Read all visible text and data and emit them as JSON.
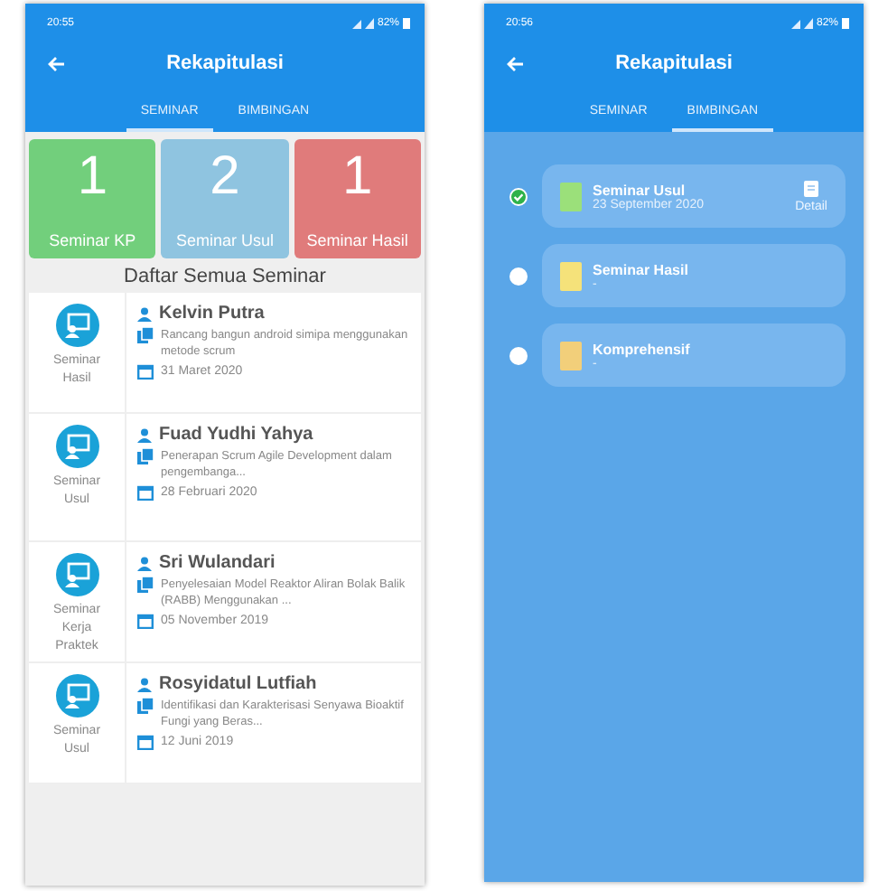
{
  "screens": [
    {
      "kind": "seminar",
      "status_bar": {
        "time": "20:55",
        "battery": "82%"
      },
      "title": "Rekapitulasi",
      "tabs": [
        {
          "label": "SEMINAR",
          "selected": true
        },
        {
          "label": "BIMBINGAN",
          "selected": false
        }
      ],
      "stats": [
        {
          "count": "1",
          "label": "Seminar KP",
          "color": "#72cf7c"
        },
        {
          "count": "2",
          "label": "Seminar Usul",
          "color": "#8fc4e0"
        },
        {
          "count": "1",
          "label": "Seminar Hasil",
          "color": "#e07b7b"
        }
      ],
      "list_title": "Daftar Semua Seminar",
      "seminars": [
        {
          "type": "Seminar Hasil",
          "name": "Kelvin Putra",
          "title": "Rancang bangun android simipa menggunakan metode scrum",
          "date": "31 Maret 2020"
        },
        {
          "type": "Seminar Usul",
          "name": "Fuad Yudhi Yahya",
          "title": "Penerapan Scrum Agile Development dalam pengembanga...",
          "date": "28 Februari 2020"
        },
        {
          "type": "Seminar Kerja Praktek",
          "name": "Sri Wulandari",
          "title": "Penyelesaian Model Reaktor Aliran Bolak Balik (RABB) Menggunakan ...",
          "date": "05 November 2019"
        },
        {
          "type": "Seminar Usul",
          "name": "Rosyidatul Lutfiah",
          "title": "Identifikasi dan Karakterisasi Senyawa Bioaktif Fungi yang Beras...",
          "date": "12 Juni 2019"
        }
      ]
    },
    {
      "kind": "bimbingan",
      "status_bar": {
        "time": "20:56",
        "battery": "82%"
      },
      "title": "Rekapitulasi",
      "tabs": [
        {
          "label": "SEMINAR",
          "selected": false
        },
        {
          "label": "BIMBINGAN",
          "selected": true
        }
      ],
      "steps": [
        {
          "title": "Seminar Usul",
          "date": "23 September 2020",
          "done": true,
          "color": "#9be07a",
          "detail": "Detail"
        },
        {
          "title": "Seminar Hasil",
          "date": "-",
          "done": false,
          "color": "#f5e27a"
        },
        {
          "title": "Komprehensif",
          "date": "-",
          "done": false,
          "color": "#f2cf7a"
        }
      ]
    }
  ]
}
